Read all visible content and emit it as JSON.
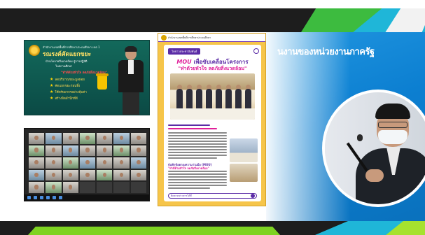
{
  "header": {
    "title": "นงานของหน่วยงานภาครัฐ"
  },
  "slide1": {
    "org_line": "สำนักงานเขตพื้นที่การศึกษาประถมศึกษา เขต 1",
    "title": "รณรงค์คัดแยกขยะ",
    "lines": [
      "นำนโยบายสิ่งแวดล้อม สู่การปฏิบัติ",
      "ในสถานศึกษา"
    ],
    "red_text": "\"ทำดีด้วยหัวใจ ลดภัยสิ่งแวดล้อม\"",
    "bullets": [
      "ลดปริมาณขยะมูลฝอย",
      "คัดแยกขยะก่อนทิ้ง",
      "ใช้ทรัพยากรอย่างคุ้มค่า",
      "สร้างจิตสำนึกที่ดี"
    ]
  },
  "poster": {
    "header_text": "สำนักงานเขตพื้นที่การศึกษาประถมศึกษา",
    "tag": "ใบข่าวประชาสัมพันธ์",
    "title_mou": "MOU",
    "title_rest": " เพื่อขับเคลื่อนโครงการ",
    "subtitle": "\"ทำด้วยหัวใจ ลดภัยสิ่งแวดล้อม\"",
    "section_title": "บันทึกข้อตกลงความร่วมมือ (MOU)",
    "section_title2": "\"ทำดีด้วยหัวใจ ลดภัยสิ่งแวดล้อม\"",
    "footer": "ติดตามข่าวสารได้ที่"
  },
  "colors": {
    "top_dark": "#1d1d1d",
    "green": "#3dbb3f",
    "cyan": "#1fb6d8",
    "blue": "#0c7fd1",
    "poster_yellow": "#f6c54a",
    "poster_purple": "#5b2ca6",
    "poster_pink": "#e0209a"
  }
}
